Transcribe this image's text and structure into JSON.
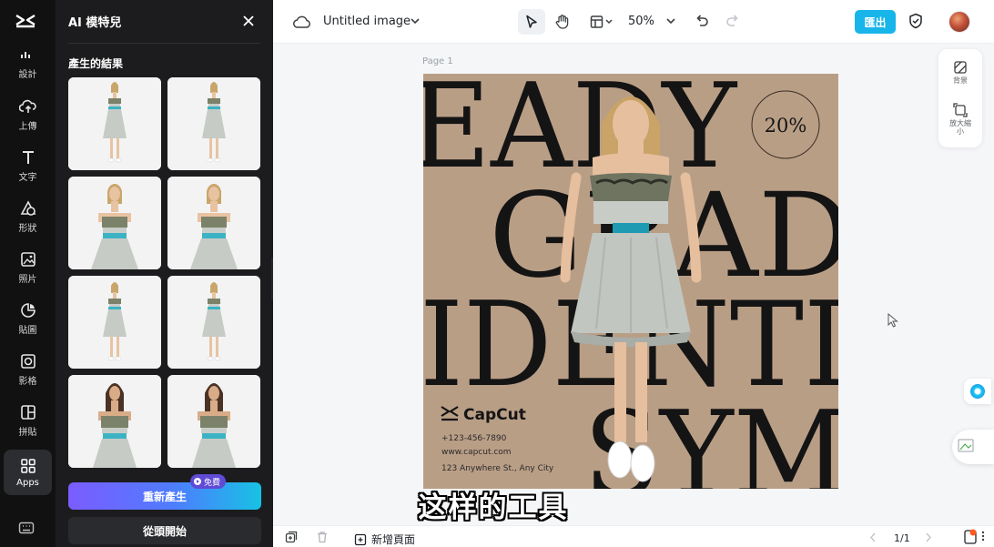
{
  "colors": {
    "rail_bg": "#111111",
    "panel_bg": "#1c1c1e",
    "accent": "#17b5ea",
    "regen_gradient": [
      "#7b5cff",
      "#17c2e4"
    ],
    "artboard_bg": "#b99e86"
  },
  "rail": {
    "logo_icon": "capcut-logo-icon",
    "items": [
      {
        "label": "設計",
        "icon": "design-icon"
      },
      {
        "label": "上傳",
        "icon": "upload-cloud-icon"
      },
      {
        "label": "文字",
        "icon": "text-icon"
      },
      {
        "label": "形狀",
        "icon": "shapes-icon"
      },
      {
        "label": "照片",
        "icon": "photo-icon"
      },
      {
        "label": "貼圖",
        "icon": "sticker-icon"
      },
      {
        "label": "影格",
        "icon": "frame-icon"
      },
      {
        "label": "拼貼",
        "icon": "collage-icon"
      },
      {
        "label": "Apps",
        "icon": "apps-grid-icon",
        "active": true
      }
    ],
    "bottom_icon": "keyboard-icon"
  },
  "panel": {
    "title": "AI 模特兒",
    "results_heading": "產生的結果",
    "result_count": 8,
    "regenerate_label": "重新產生",
    "free_badge": "免費",
    "restart_label": "從頭開始"
  },
  "topbar": {
    "doc_title": "Untitled image",
    "zoom": "50%",
    "export_label": "匯出"
  },
  "canvas": {
    "page_label": "Page 1",
    "design": {
      "headline_lines": [
        "EADY",
        "GRAD",
        "IDENTI",
        "SYM"
      ],
      "badge": "20%",
      "brand": "CapCut",
      "phone": "+123-456-7890",
      "website": "www.capcut.com",
      "address": "123 Anywhere St., Any City"
    },
    "side_tools": [
      {
        "label": "背景",
        "icon": "background-icon"
      },
      {
        "label": "放大縮小",
        "icon": "resize-icon"
      }
    ]
  },
  "subtitle": "这样的工具",
  "bottombar": {
    "add_page_label": "新增頁面",
    "page_counter": "1/1"
  }
}
